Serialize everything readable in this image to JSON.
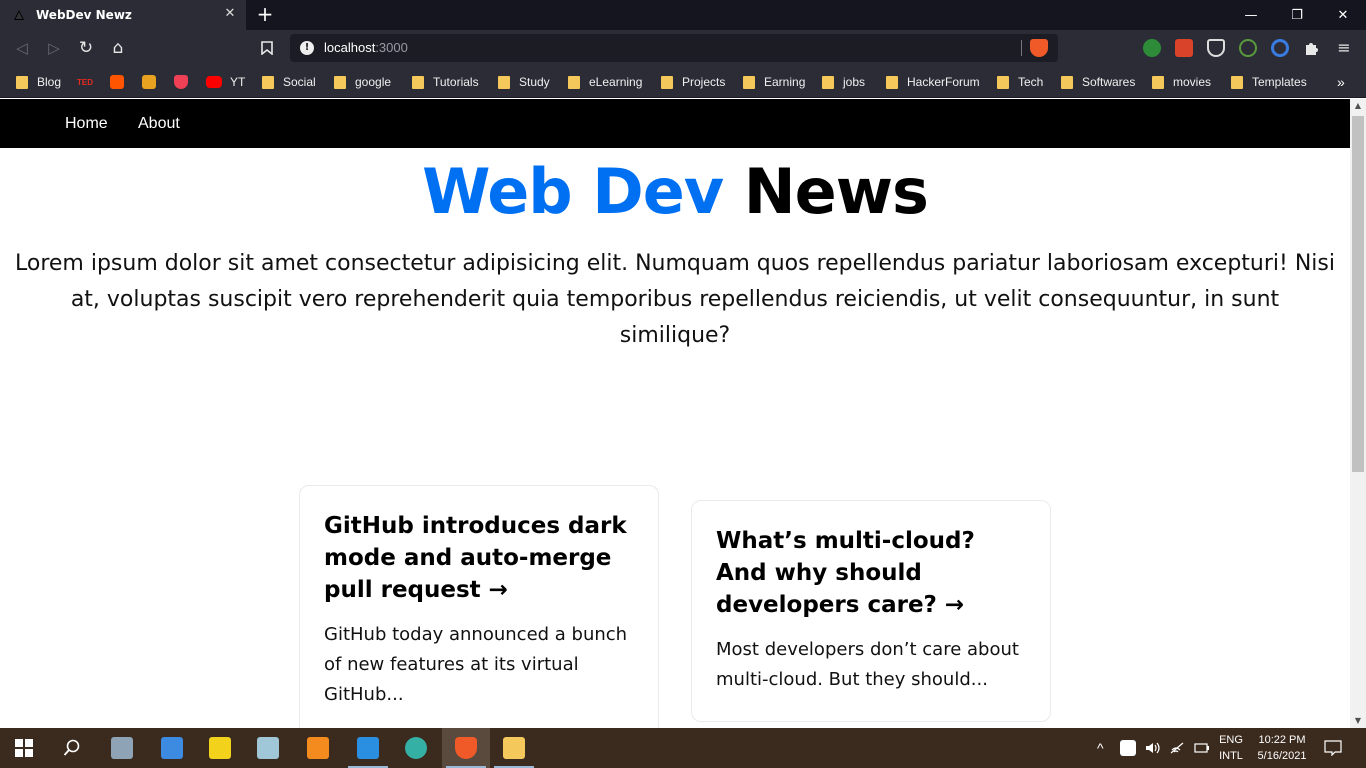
{
  "browser": {
    "tab_title": "WebDev Newz",
    "tab_close": "✕",
    "new_tab": "+",
    "window_controls": {
      "minimize": "—",
      "restore": "❐",
      "close": "✕"
    },
    "nav": {
      "back": "◁",
      "forward": "▷",
      "reload": "↻",
      "home": "⌂",
      "bookmark": "🔖"
    },
    "url_host": "localhost",
    "url_port": ":3000",
    "bookmarks": [
      {
        "label": "Blog",
        "kind": "folder"
      },
      {
        "label": "",
        "kind": "ted"
      },
      {
        "label": "",
        "kind": "soundcloud"
      },
      {
        "label": "",
        "kind": "office"
      },
      {
        "label": "",
        "kind": "pocket"
      },
      {
        "label": "YT",
        "kind": "youtube"
      },
      {
        "label": "Social",
        "kind": "folder"
      },
      {
        "label": "google",
        "kind": "folder"
      },
      {
        "label": "Tutorials",
        "kind": "folder"
      },
      {
        "label": "Study",
        "kind": "folder"
      },
      {
        "label": "eLearning",
        "kind": "folder"
      },
      {
        "label": "Projects",
        "kind": "folder"
      },
      {
        "label": "Earning",
        "kind": "folder"
      },
      {
        "label": "jobs",
        "kind": "folder"
      },
      {
        "label": "HackerForum",
        "kind": "folder"
      },
      {
        "label": "Tech",
        "kind": "folder"
      },
      {
        "label": "Softwares",
        "kind": "folder"
      },
      {
        "label": "movies",
        "kind": "folder"
      },
      {
        "label": "Templates",
        "kind": "folder"
      }
    ],
    "bookmarks_more": "»",
    "ted_text": "TED"
  },
  "site": {
    "nav": {
      "home": "Home",
      "about": "About"
    },
    "title_part1": "Web Dev",
    "title_part2": "News",
    "description": "Lorem ipsum dolor sit amet consectetur adipisicing elit. Numquam quos repellendus pariatur laboriosam excepturi! Nisi at, voluptas suscipit vero reprehenderit quia temporibus repellendus reiciendis, ut velit consequuntur, in sunt similique?",
    "articles": [
      {
        "title": "GitHub introduces dark mode and auto-merge pull request →",
        "excerpt": "GitHub today announced a bunch of new features at its virtual GitHub..."
      },
      {
        "title": "What’s multi-cloud? And why should developers care? →",
        "excerpt": "Most developers don’t care about multi-cloud. But they should..."
      }
    ]
  },
  "taskbar": {
    "lang_top": "ENG",
    "lang_bottom": "INTL",
    "time": "10:22 PM",
    "date": "5/16/2021",
    "tray_chevron": "^"
  },
  "colors": {
    "accent_blue": "#0070f3",
    "nav_bg": "#000000",
    "brave_orange": "#f05a28"
  }
}
